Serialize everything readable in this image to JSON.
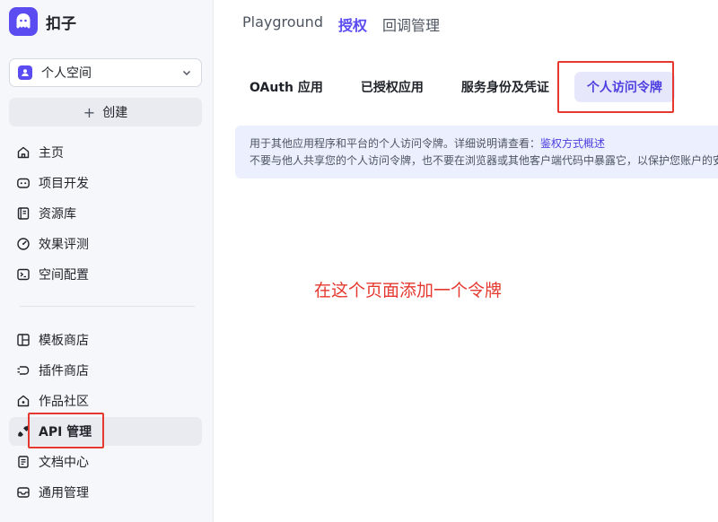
{
  "app": {
    "name": "扣子"
  },
  "sidebar": {
    "space_selector": {
      "label": "个人空间"
    },
    "create_label": "创建",
    "primary_items": [
      {
        "label": "主页",
        "icon": "home-icon"
      },
      {
        "label": "项目开发",
        "icon": "bot-icon"
      },
      {
        "label": "资源库",
        "icon": "library-icon"
      },
      {
        "label": "效果评测",
        "icon": "gauge-icon"
      },
      {
        "label": "空间配置",
        "icon": "terminal-icon"
      }
    ],
    "secondary_items": [
      {
        "label": "模板商店",
        "icon": "template-icon"
      },
      {
        "label": "插件商店",
        "icon": "plugin-icon"
      },
      {
        "label": "作品社区",
        "icon": "community-icon"
      },
      {
        "label": "API 管理",
        "icon": "api-icon",
        "active": true
      },
      {
        "label": "文档中心",
        "icon": "document-icon"
      },
      {
        "label": "通用管理",
        "icon": "inbox-icon"
      }
    ]
  },
  "top_nav": [
    {
      "label": "Playground"
    },
    {
      "label": "授权",
      "active": true
    },
    {
      "label": "回调管理"
    }
  ],
  "tabs": [
    {
      "label": "OAuth 应用"
    },
    {
      "label": "已授权应用"
    },
    {
      "label": "服务身份及凭证"
    },
    {
      "label": "个人访问令牌",
      "active": true
    }
  ],
  "notice": {
    "line1_text": "用于其他应用程序和平台的个人访问令牌。详细说明请查看：",
    "line1_link": "鉴权方式概述",
    "line2_text": "不要与他人共享您的个人访问令牌，也不要在浏览器或其他客户端代码中暴露它，以保护您账户的安全"
  },
  "annotation": {
    "text": "在这个页面添加一个令牌"
  },
  "colors": {
    "accent": "#5a4cf0",
    "annotation_red": "#e5392f",
    "notice_bg": "#eceffd"
  }
}
